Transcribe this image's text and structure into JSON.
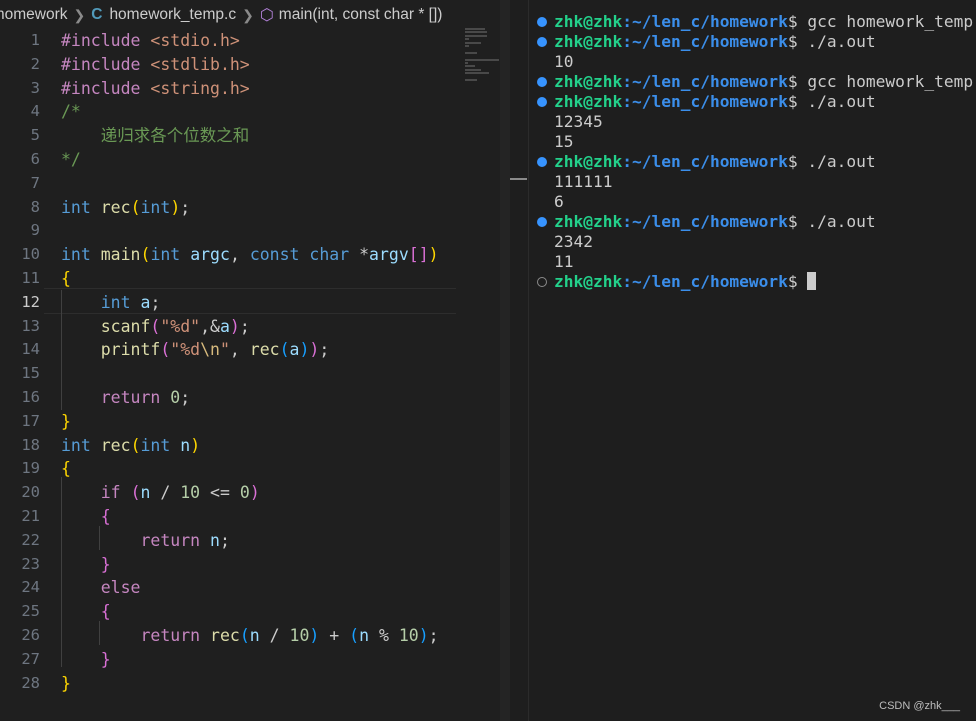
{
  "breadcrumb": {
    "folder": "homework",
    "file": "homework_temp.c",
    "symbol": "main(int, const char * [])"
  },
  "editor": {
    "line_numbers": [
      "1",
      "2",
      "3",
      "4",
      "5",
      "6",
      "7",
      "8",
      "9",
      "10",
      "11",
      "12",
      "13",
      "14",
      "15",
      "16",
      "17",
      "18",
      "19",
      "20",
      "21",
      "22",
      "23",
      "24",
      "25",
      "26",
      "27",
      "28"
    ],
    "active_line": "12",
    "code": {
      "l1a": "#include ",
      "l1b": "<stdio.h>",
      "l2a": "#include ",
      "l2b": "<stdlib.h>",
      "l3a": "#include ",
      "l3b": "<string.h>",
      "l4": "/*",
      "l5": "    递归求各个位数之和",
      "l6": "*/",
      "int": "int",
      "const": "const",
      "char": "char",
      "if": "if",
      "else": "else",
      "return": "return",
      "rec": "rec",
      "main": "main",
      "scanf": "scanf",
      "printf": "printf",
      "argc": "argc",
      "argv": "argv",
      "a": "a",
      "n": "n",
      "zero": "0",
      "ten": "10",
      "fmt1": "\"%d\"",
      "fmt2a": "\"%d",
      "fmt2b": "\\n",
      "fmt2c": "\""
    }
  },
  "terminal": {
    "user": "zhk@zhk",
    "path": ":~/len_c/homework",
    "prompt_symbol": "$",
    "lines": [
      {
        "kind": "cmd",
        "text": " gcc homework_temp.c"
      },
      {
        "kind": "cmd",
        "text": " ./a.out"
      },
      {
        "kind": "out",
        "text": "10"
      },
      {
        "kind": "cmd",
        "text": " gcc homework_temp.c"
      },
      {
        "kind": "cmd",
        "text": " ./a.out"
      },
      {
        "kind": "out",
        "text": "12345"
      },
      {
        "kind": "out",
        "text": "15"
      },
      {
        "kind": "cmd",
        "text": " ./a.out"
      },
      {
        "kind": "out",
        "text": "111111"
      },
      {
        "kind": "out",
        "text": "6"
      },
      {
        "kind": "cmd",
        "text": " ./a.out"
      },
      {
        "kind": "out",
        "text": "2342"
      },
      {
        "kind": "out",
        "text": "11"
      },
      {
        "kind": "prompt",
        "text": ""
      }
    ]
  },
  "watermark": "CSDN @zhk___",
  "colors": {
    "keyword": "#569cd6",
    "function": "#dcdcaa",
    "comment": "#6a9955",
    "string": "#ce9178",
    "number": "#b5cea8",
    "terminal_user": "#23d18b",
    "terminal_path": "#3b8eea",
    "decoration_dot": "#3794ff"
  },
  "icons": [
    "chevron-right-icon",
    "c-file-icon",
    "method-cube-icon",
    "terminal-decoration-dot-icon"
  ]
}
